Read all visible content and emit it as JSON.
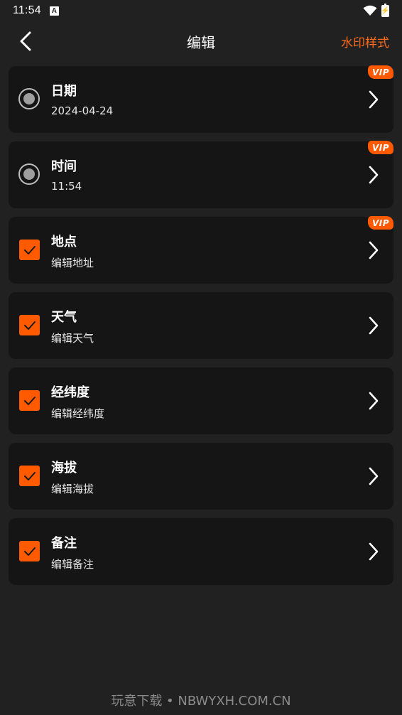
{
  "status_bar": {
    "time": "11:54",
    "app_icon": "A",
    "battery_glyph": "⚡"
  },
  "header": {
    "title": "编辑",
    "action_label": "水印样式"
  },
  "items": [
    {
      "title": "日期",
      "subtitle": "2024-04-24",
      "control": "radio",
      "vip": "VIP"
    },
    {
      "title": "时间",
      "subtitle": "11:54",
      "control": "radio",
      "vip": "VIP"
    },
    {
      "title": "地点",
      "subtitle": "编辑地址",
      "control": "checkbox",
      "vip": "VIP"
    },
    {
      "title": "天气",
      "subtitle": "编辑天气",
      "control": "checkbox",
      "vip": ""
    },
    {
      "title": "经纬度",
      "subtitle": "编辑经纬度",
      "control": "checkbox",
      "vip": ""
    },
    {
      "title": "海拔",
      "subtitle": "编辑海拔",
      "control": "checkbox",
      "vip": ""
    },
    {
      "title": "备注",
      "subtitle": "编辑备注",
      "control": "checkbox",
      "vip": ""
    }
  ],
  "footer": {
    "watermark_text": "玩意下载 • NBWYXH.COM.CN"
  },
  "colors": {
    "accent": "#ff5a00",
    "accent_text": "#ff6b1a",
    "background": "#212121",
    "card": "#151515"
  },
  "icons": {
    "back": "chevron-left-icon",
    "row_arrow": "chevron-right-icon",
    "check": "checkmark-icon",
    "wifi": "wifi-icon",
    "battery": "battery-icon"
  }
}
